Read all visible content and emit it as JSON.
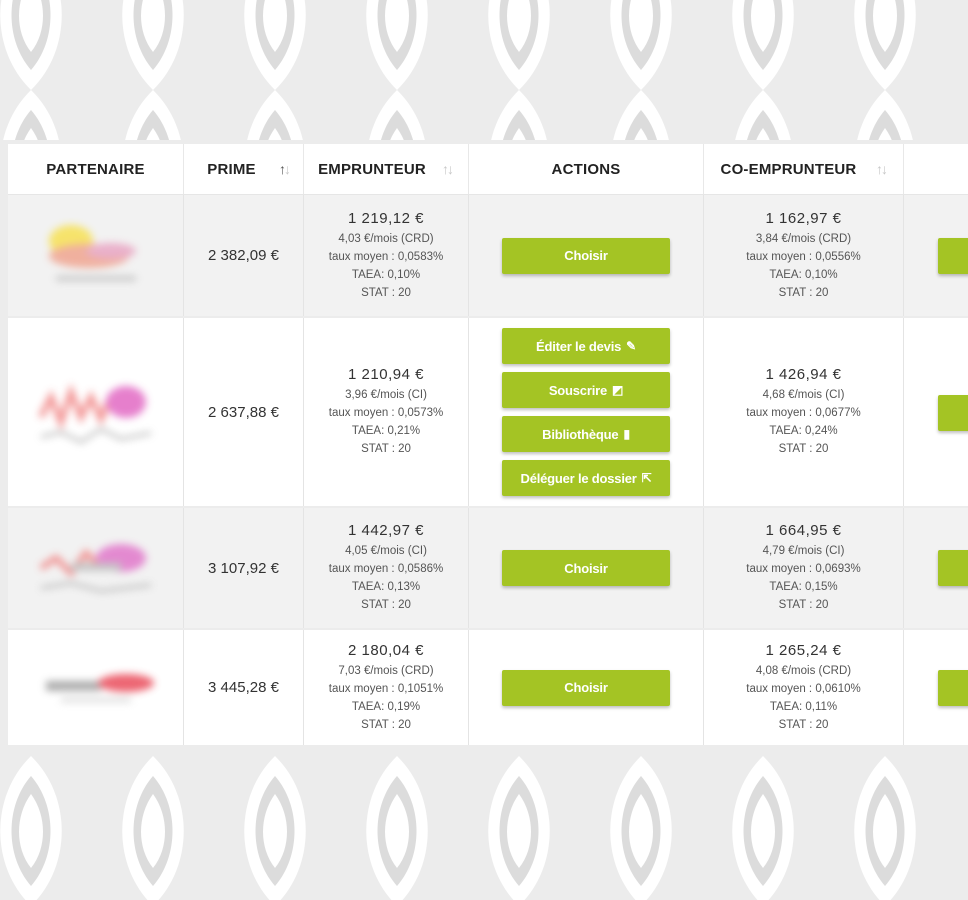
{
  "colors": {
    "accent": "#a4c424",
    "header_bg": "#ffffff",
    "row_alt": "#f2f2f2"
  },
  "headers": {
    "partenaire": "PARTENAIRE",
    "prime": "PRIME",
    "emprunteur": "EMPRUNTEUR",
    "actions": "ACTIONS",
    "co_emprunteur": "CO-EMPRUNTEUR",
    "sort_icon": "↑↓"
  },
  "rows": [
    {
      "prime": "2 382,09 €",
      "emprunteur": {
        "amount": "1 219,12 €",
        "monthly": "4,03 €/mois (CRD)",
        "taux": "taux moyen : 0,0583%",
        "taea": "TAEA: 0,10%",
        "stat": "STAT : 20"
      },
      "actions": [
        "Choisir"
      ],
      "co_emprunteur": {
        "amount": "1 162,97 €",
        "monthly": "3,84 €/mois (CRD)",
        "taux": "taux moyen : 0,0556%",
        "taea": "TAEA: 0,10%",
        "stat": "STAT : 20"
      }
    },
    {
      "prime": "2 637,88 €",
      "emprunteur": {
        "amount": "1 210,94 €",
        "monthly": "3,96 €/mois (CI)",
        "taux": "taux moyen : 0,0573%",
        "taea": "TAEA: 0,21%",
        "stat": "STAT : 20"
      },
      "actions": [
        "Éditer le devis",
        "Souscrire",
        "Bibliothèque",
        "Déléguer le dossier"
      ],
      "co_emprunteur": {
        "amount": "1 426,94 €",
        "monthly": "4,68 €/mois (CI)",
        "taux": "taux moyen : 0,0677%",
        "taea": "TAEA: 0,24%",
        "stat": "STAT : 20"
      }
    },
    {
      "prime": "3 107,92 €",
      "emprunteur": {
        "amount": "1 442,97 €",
        "monthly": "4,05 €/mois (CI)",
        "taux": "taux moyen : 0,0586%",
        "taea": "TAEA: 0,13%",
        "stat": "STAT : 20"
      },
      "actions": [
        "Choisir"
      ],
      "co_emprunteur": {
        "amount": "1 664,95 €",
        "monthly": "4,79 €/mois (CI)",
        "taux": "taux moyen : 0,0693%",
        "taea": "TAEA: 0,15%",
        "stat": "STAT : 20"
      }
    },
    {
      "prime": "3 445,28 €",
      "emprunteur": {
        "amount": "2 180,04 €",
        "monthly": "7,03 €/mois (CRD)",
        "taux": "taux moyen : 0,1051%",
        "taea": "TAEA: 0,19%",
        "stat": "STAT : 20"
      },
      "actions": [
        "Choisir"
      ],
      "co_emprunteur": {
        "amount": "1 265,24 €",
        "monthly": "4,08 €/mois (CRD)",
        "taux": "taux moyen : 0,0610%",
        "taea": "TAEA: 0,11%",
        "stat": "STAT : 20"
      }
    }
  ]
}
